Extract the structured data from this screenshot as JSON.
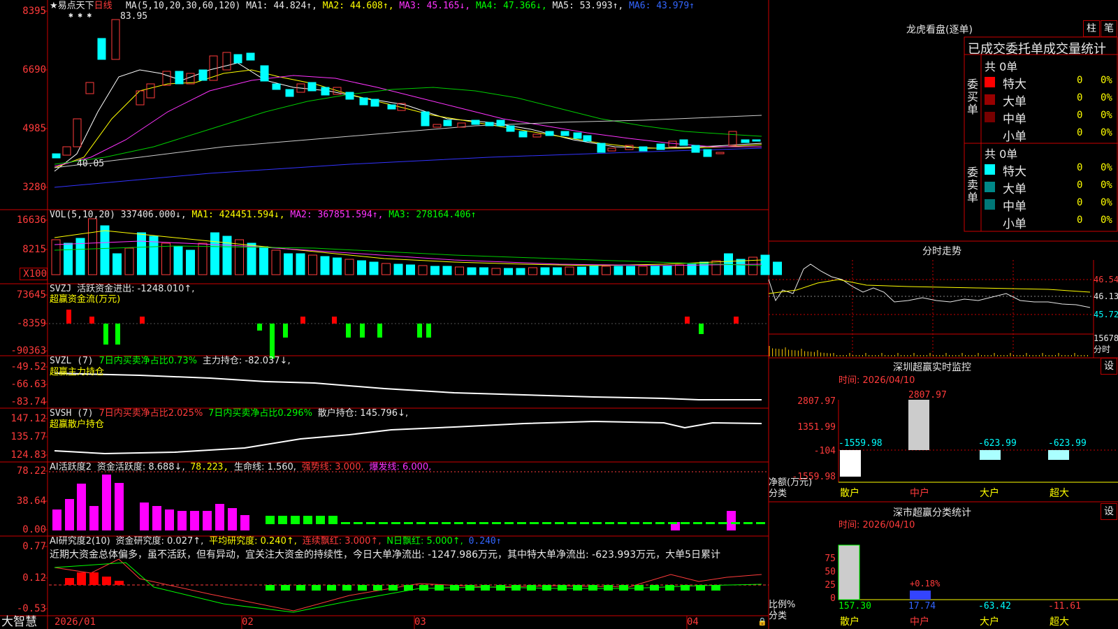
{
  "colors": {
    "up": "#ff3b3b",
    "down": "#00ffff",
    "ma1": "#ffffff",
    "ma2": "#ffff00",
    "ma3": "#ff33ff",
    "ma4": "#00cc00",
    "ma5": "#cccccc",
    "ma6": "#3333ff",
    "grid": "#cc0000"
  },
  "main": {
    "star": "★",
    "name": "易点天下",
    "period": "日线",
    "ma_label": "MA(5,10,20,30,60,120)",
    "ma1": "MA1: 44.824↑,",
    "ma2": "MA2: 44.608↑,",
    "ma3": "MA3: 45.165↓,",
    "ma4": "MA4: 47.366↓,",
    "ma5": "MA5: 53.993↑,",
    "ma6": "MA6: 43.979↑",
    "y_labels": [
      "8395",
      "6690",
      "4985",
      "3280"
    ],
    "high_label": "83.95",
    "low_label": "40.05",
    "marks": "✱ ✱ ✱"
  },
  "vol": {
    "label": "VOL(5,10,20)",
    "v": "337406.000↓,",
    "ma1": "MA1: 424451.594↓,",
    "ma2": "MA2: 367851.594↑,",
    "ma3": "MA3: 278164.406↑",
    "y_labels": [
      "16636",
      "8215"
    ],
    "unit": "X100"
  },
  "svzj": {
    "label": "SVZJ",
    "text": "活跃资金进出: -1248.010↑,",
    "sub": "超赢资金流(万元)",
    "y_labels": [
      "73645",
      "-8359",
      "-90363"
    ]
  },
  "svzl": {
    "label": "SVZL (7)",
    "t1": "7日内买卖净占比0.73%",
    "t2": "主力持仓: -82.037↓,",
    "sub": "超赢主力持仓",
    "y_labels": [
      "-49.52",
      "-66.63",
      "-83.74"
    ]
  },
  "svsh": {
    "label": "SVSH (7)",
    "t1": "7日内买卖净占比2.025%",
    "t2": "7日内买卖净占比0.296%",
    "t3": "散户持仓: 145.796↓,",
    "sub": "超赢散户持仓",
    "y_labels": [
      "147.12",
      "135.77",
      "124.83"
    ]
  },
  "ai1": {
    "label": "AI活跃度2",
    "t1": "资金活跃度: 8.688↓,",
    "t2": "78.223,",
    "t3": "生命线: 1.560,",
    "t4": "强势线: 3.000,",
    "t5": "爆发线: 6.000,",
    "y_labels": [
      "78.22",
      "38.64",
      "0.00"
    ]
  },
  "ai2": {
    "label": "AI研究度2(10)",
    "t1": "资金研究度: 0.027↑,",
    "t2": "平均研究度: 0.240↑,",
    "t3": "连续飘红: 3.000↑,",
    "t4": "N日飘红: 5.000↑,",
    "t5": "0.240↑",
    "comment": "近期大资金总体偏多，虽不活跃，但有异动，宜关注大资金的持续性，今日大单净流出: -1247.986万元，其中特大单净流出: -623.993万元，大单5日累计",
    "y_labels": [
      "0.77",
      "0.12",
      "-0.53"
    ]
  },
  "xaxis": {
    "brand": "大智慧",
    "labels": [
      "2026/01",
      "02",
      "03",
      "04"
    ]
  },
  "lhb": {
    "title": "龙虎看盘(逐单)",
    "btn1": "柱",
    "btn2": "笔",
    "header": "已成交委托单成交量统计",
    "buy": {
      "side": "委买单",
      "total": "共 0单",
      "rows": [
        {
          "name": "特大",
          "count": "0",
          "pct": "0%",
          "color": "#ff0000"
        },
        {
          "name": "大单",
          "count": "0",
          "pct": "0%",
          "color": "#990000"
        },
        {
          "name": "中单",
          "count": "0",
          "pct": "0%",
          "color": "#770000"
        },
        {
          "name": "小单",
          "count": "0",
          "pct": "0%",
          "color": "#000000"
        }
      ]
    },
    "sell": {
      "side": "委卖单",
      "total": "共 0单",
      "rows": [
        {
          "name": "特大",
          "count": "0",
          "pct": "0%",
          "color": "#00ffff"
        },
        {
          "name": "大单",
          "count": "0",
          "pct": "0%",
          "color": "#008888"
        },
        {
          "name": "中单",
          "count": "0",
          "pct": "0%",
          "color": "#007777"
        },
        {
          "name": "小单",
          "count": "0",
          "pct": "0%",
          "color": "#000000"
        }
      ]
    }
  },
  "fenshi": {
    "title": "分时走势",
    "prices": [
      "46.54",
      "46.13",
      "45.72"
    ],
    "vol": "15678",
    "vol_unit": "分时"
  },
  "monitor": {
    "title": "深圳超赢实时监控",
    "btn": "设",
    "time": "时间: 2026/04/10",
    "y_labels": [
      "2807.97",
      "1351.99",
      "-104",
      "-1559.98"
    ],
    "ylabel1": "净额(万元)",
    "ylabel2": "分类",
    "bars": [
      {
        "cat": "散户",
        "value": "-1559.98",
        "cat_color": "#ffff00",
        "val_color": "#00ffff"
      },
      {
        "cat": "中户",
        "value": "2807.97",
        "cat_color": "#ff3b3b",
        "val_color": "#ff3b3b"
      },
      {
        "cat": "大户",
        "value": "-623.99",
        "cat_color": "#ffff00",
        "val_color": "#00ffff"
      },
      {
        "cat": "超大",
        "value": "-623.99",
        "cat_color": "#ffff00",
        "val_color": "#00ffff"
      }
    ]
  },
  "classify": {
    "title": "深市超赢分类统计",
    "btn": "设",
    "time": "时间: 2026/04/10",
    "y_labels": [
      "75",
      "50",
      "25",
      "0"
    ],
    "ylabel1": "比例%",
    "ylabel2": "分类",
    "bars": [
      {
        "cat": "散户",
        "value": "157.30",
        "cat_color": "#ffff00",
        "val_color": "#00ff00"
      },
      {
        "cat": "中户",
        "value": "17.74",
        "cat_color": "#ff3b3b",
        "val_color": "#3366ff"
      },
      {
        "cat": "大户",
        "value": "-63.42",
        "cat_color": "#ffff00",
        "val_color": "#00ffff"
      },
      {
        "cat": "超大",
        "value": "-11.61",
        "cat_color": "#ffff00",
        "val_color": "#ff3b3b"
      }
    ],
    "annot": "+0.18%"
  }
}
